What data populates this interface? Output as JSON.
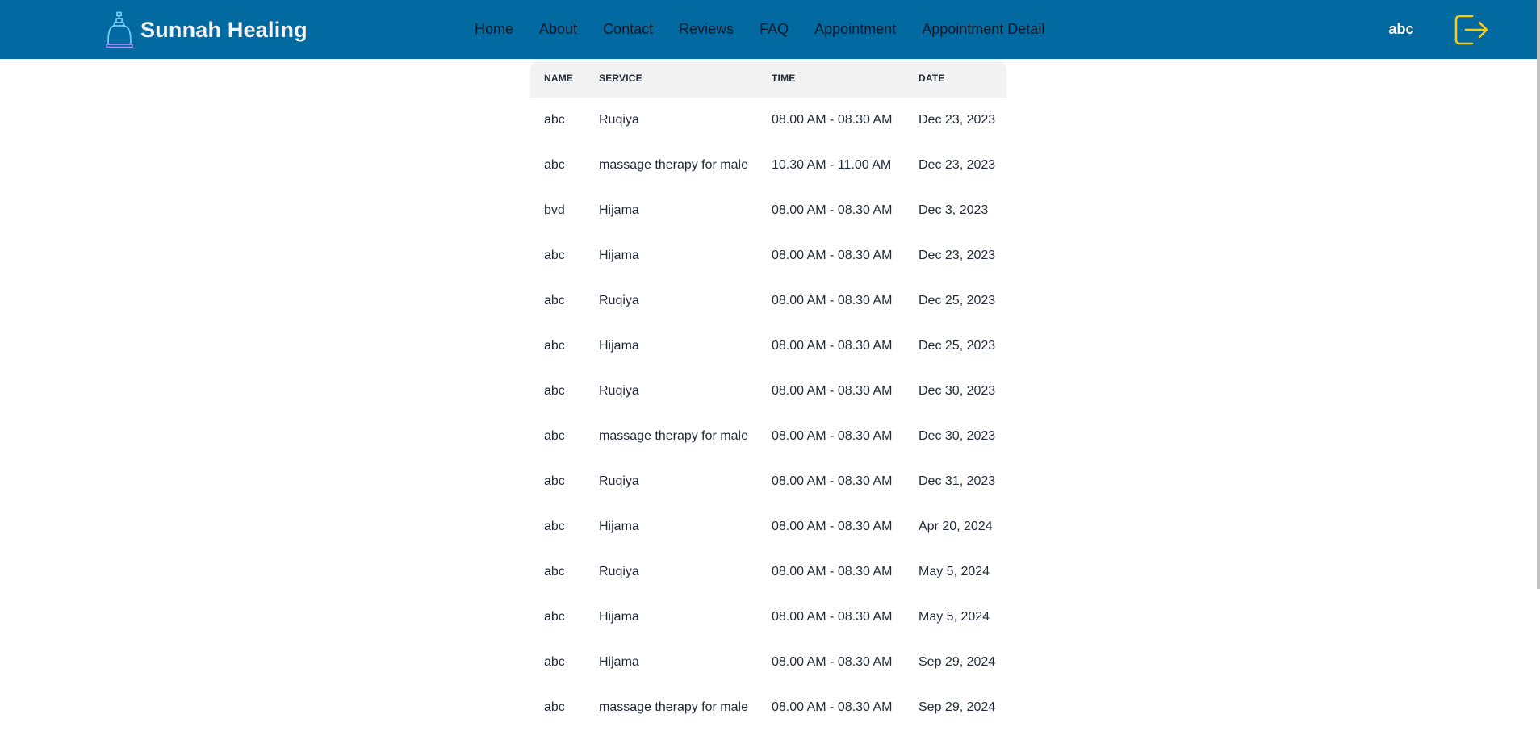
{
  "brand": {
    "title": "Sunnah Healing",
    "icon": "cupping-jar-icon"
  },
  "nav": {
    "items": [
      {
        "label": "Home"
      },
      {
        "label": "About"
      },
      {
        "label": "Contact"
      },
      {
        "label": "Reviews"
      },
      {
        "label": "FAQ"
      },
      {
        "label": "Appointment"
      },
      {
        "label": "Appointment Detail"
      }
    ]
  },
  "user": {
    "name": "abc",
    "logout_icon": "logout-icon"
  },
  "colors": {
    "navbar": "#0369a1",
    "logout_icon": "#facc15",
    "header_row": "#f3f3f3"
  },
  "table": {
    "headers": [
      "NAME",
      "SERVICE",
      "TIME",
      "DATE"
    ],
    "rows": [
      {
        "name": "abc",
        "service": "Ruqiya",
        "time": "08.00 AM - 08.30 AM",
        "date": "Dec 23, 2023"
      },
      {
        "name": "abc",
        "service": "massage therapy for male",
        "time": "10.30 AM - 11.00 AM",
        "date": "Dec 23, 2023"
      },
      {
        "name": "bvd",
        "service": "Hijama",
        "time": "08.00 AM - 08.30 AM",
        "date": "Dec 3, 2023"
      },
      {
        "name": "abc",
        "service": "Hijama",
        "time": "08.00 AM - 08.30 AM",
        "date": "Dec 23, 2023"
      },
      {
        "name": "abc",
        "service": "Ruqiya",
        "time": "08.00 AM - 08.30 AM",
        "date": "Dec 25, 2023"
      },
      {
        "name": "abc",
        "service": "Hijama",
        "time": "08.00 AM - 08.30 AM",
        "date": "Dec 25, 2023"
      },
      {
        "name": "abc",
        "service": "Ruqiya",
        "time": "08.00 AM - 08.30 AM",
        "date": "Dec 30, 2023"
      },
      {
        "name": "abc",
        "service": "massage therapy for male",
        "time": "08.00 AM - 08.30 AM",
        "date": "Dec 30, 2023"
      },
      {
        "name": "abc",
        "service": "Ruqiya",
        "time": "08.00 AM - 08.30 AM",
        "date": "Dec 31, 2023"
      },
      {
        "name": "abc",
        "service": "Hijama",
        "time": "08.00 AM - 08.30 AM",
        "date": "Apr 20, 2024"
      },
      {
        "name": "abc",
        "service": "Ruqiya",
        "time": "08.00 AM - 08.30 AM",
        "date": "May 5, 2024"
      },
      {
        "name": "abc",
        "service": "Hijama",
        "time": "08.00 AM - 08.30 AM",
        "date": "May 5, 2024"
      },
      {
        "name": "abc",
        "service": "Hijama",
        "time": "08.00 AM - 08.30 AM",
        "date": "Sep 29, 2024"
      },
      {
        "name": "abc",
        "service": "massage therapy for male",
        "time": "08.00 AM - 08.30 AM",
        "date": "Sep 29, 2024"
      }
    ]
  }
}
